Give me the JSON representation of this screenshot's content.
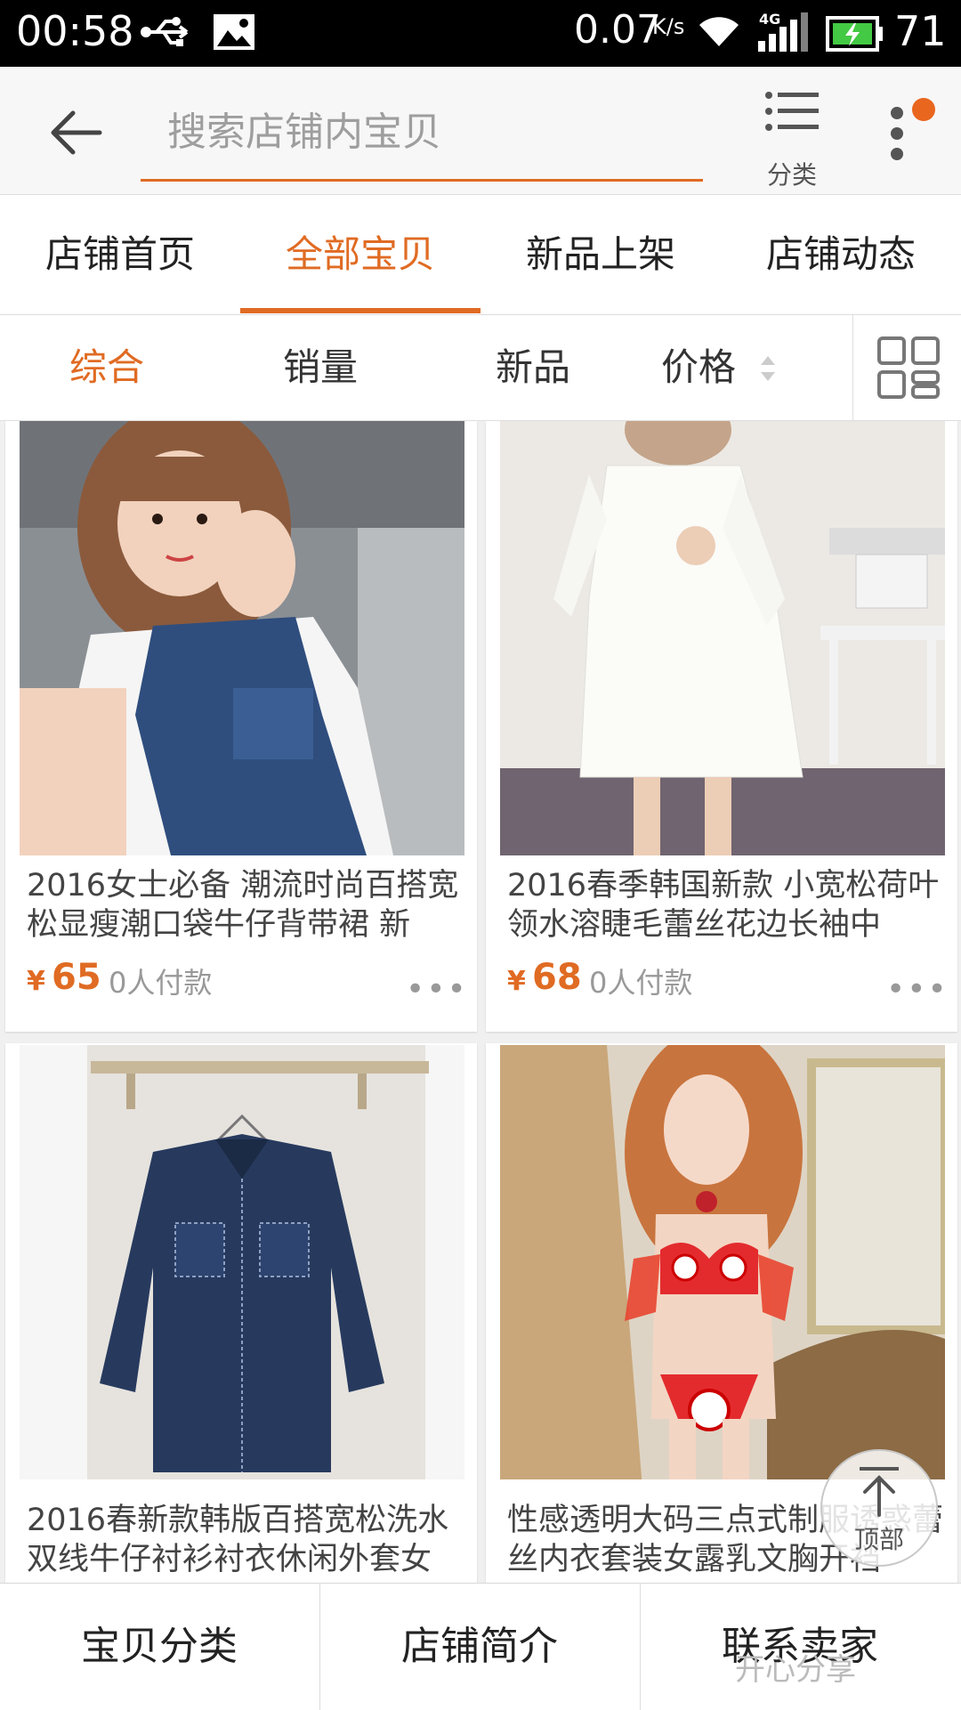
{
  "status_bar": {
    "time": "00:58",
    "net_speed": "0.07",
    "net_speed_unit": "K/s",
    "network_type": "4G",
    "battery_level": "71",
    "icons": [
      "usb-icon",
      "image-icon",
      "wifi-icon",
      "signal-icon",
      "battery-charging-icon"
    ]
  },
  "header": {
    "search_placeholder": "搜索店铺内宝贝",
    "category_label": "分类",
    "accent_color": "#e06b23"
  },
  "tabs": [
    {
      "label": "店铺首页",
      "active": false
    },
    {
      "label": "全部宝贝",
      "active": true
    },
    {
      "label": "新品上架",
      "active": false
    },
    {
      "label": "店铺动态",
      "active": false
    }
  ],
  "sort": [
    {
      "label": "综合",
      "active": true
    },
    {
      "label": "销量",
      "active": false
    },
    {
      "label": "新品",
      "active": false
    },
    {
      "label": "价格",
      "active": false
    }
  ],
  "products": [
    {
      "title": "2016女士必备  潮流时尚百搭宽松显瘦潮口袋牛仔背带裙 新",
      "currency": "¥",
      "price": "65",
      "sold": "0人付款"
    },
    {
      "title": "2016春季韩国新款 小宽松荷叶领水溶睫毛蕾丝花边长袖中",
      "currency": "¥",
      "price": "68",
      "sold": "0人付款"
    },
    {
      "title": "2016春新款韩版百搭宽松洗水双线牛仔衬衫衬衣休闲外套女",
      "currency": "¥",
      "price": "",
      "sold": ""
    },
    {
      "title": "性感透明大码三点式制服诱惑蕾丝内衣套装女露乳文胸开裆",
      "currency": "¥",
      "price": "",
      "sold": ""
    }
  ],
  "back_to_top_label": "顶部",
  "bottom_bar": [
    {
      "label": "宝贝分类"
    },
    {
      "label": "店铺简介"
    },
    {
      "label": "联系卖家"
    }
  ],
  "watermark": "开心分享"
}
